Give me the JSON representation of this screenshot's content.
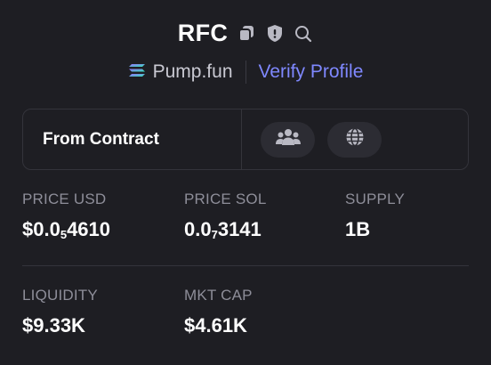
{
  "header": {
    "token_name": "RFC",
    "icons": [
      "copy-icon",
      "shield-icon",
      "search-icon"
    ]
  },
  "platform": {
    "icon": "solana-icon",
    "name": "Pump.fun",
    "verify_label": "Verify Profile"
  },
  "contract": {
    "label": "From Contract",
    "buttons": [
      "community-icon",
      "globe-icon"
    ]
  },
  "stats": {
    "price_usd": {
      "label": "PRICE USD",
      "prefix": "$0.0",
      "zeros": "5",
      "digits": "4610"
    },
    "price_sol": {
      "label": "PRICE SOL",
      "prefix": "0.0",
      "zeros": "7",
      "digits": "3141"
    },
    "supply": {
      "label": "SUPPLY",
      "value": "1B"
    },
    "liquidity": {
      "label": "LIQUIDITY",
      "value": "$9.33K"
    },
    "mkt_cap": {
      "label": "MKT CAP",
      "value": "$4.61K"
    }
  },
  "colors": {
    "background": "#1e1e23",
    "accent": "#7f88ff",
    "muted": "#8e8e99",
    "border": "#34343b"
  }
}
